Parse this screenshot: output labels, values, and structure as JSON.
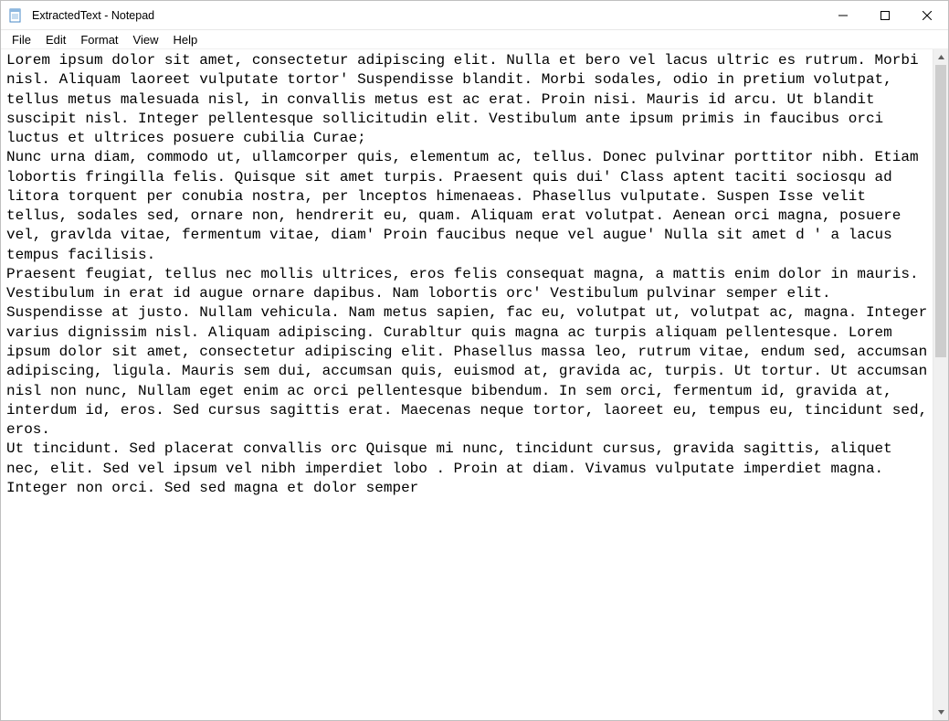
{
  "window": {
    "title": "ExtractedText - Notepad"
  },
  "menu": {
    "file": "File",
    "edit": "Edit",
    "format": "Format",
    "view": "View",
    "help": "Help"
  },
  "document": {
    "text": "Lorem ipsum dolor sit amet, consectetur adipiscing elit. Nulla et bero vel lacus ultric es rutrum. Morbi nisl. Aliquam laoreet vulputate tortor' Suspendisse blandit. Morbi sodales, odio in pretium volutpat, tellus metus malesuada nisl, in convallis metus est ac erat. Proin nisi. Mauris id arcu. Ut blandit suscipit nisl. Integer pellentesque sollicitudin elit. Vestibulum ante ipsum primis in faucibus orci luctus et ultrices posuere cubilia Curae;\nNunc urna diam, commodo ut, ullamcorper quis, elementum ac, tellus. Donec pulvinar porttitor nibh. Etiam lobortis fringilla felis. Quisque sit amet turpis. Praesent quis dui' Class aptent taciti sociosqu ad litora torquent per conubia nostra, per lnceptos himenaeas. Phasellus vulputate. Suspen Isse velit tellus, sodales sed, ornare non, hendrerit eu, quam. Aliquam erat volutpat. Aenean orci magna, posuere vel, gravlda vitae, fermentum vitae, diam' Proin faucibus neque vel augue' Nulla sit amet d ' a lacus tempus facilisis.\nPraesent feugiat, tellus nec mollis ultrices, eros felis consequat magna, a mattis enim dolor in mauris. Vestibulum in erat id augue ornare dapibus. Nam lobortis orc' Vestibulum pulvinar semper elit. Suspendisse at justo. Nullam vehicula. Nam metus sapien, fac eu, volutpat ut, volutpat ac, magna. Integer varius dignissim nisl. Aliquam adipiscing. Curabltur quis magna ac turpis aliquam pellentesque. Lorem ipsum dolor sit amet, consectetur adipiscing elit. Phasellus massa leo, rutrum vitae, endum sed, accumsan adipiscing, ligula. Mauris sem dui, accumsan quis, euismod at, gravida ac, turpis. Ut tortur. Ut accumsan nisl non nunc, Nullam eget enim ac orci pellentesque bibendum. In sem orci, fermentum id, gravida at, interdum id, eros. Sed cursus sagittis erat. Maecenas neque tortor, laoreet eu, tempus eu, tincidunt sed, eros.\nUt tincidunt. Sed placerat convallis orc Quisque mi nunc, tincidunt cursus, gravida sagittis, aliquet nec, elit. Sed vel ipsum vel nibh imperdiet lobo . Proin at diam. Vivamus vulputate imperdiet magna. Integer non orci. Sed sed magna et dolor semper"
  }
}
